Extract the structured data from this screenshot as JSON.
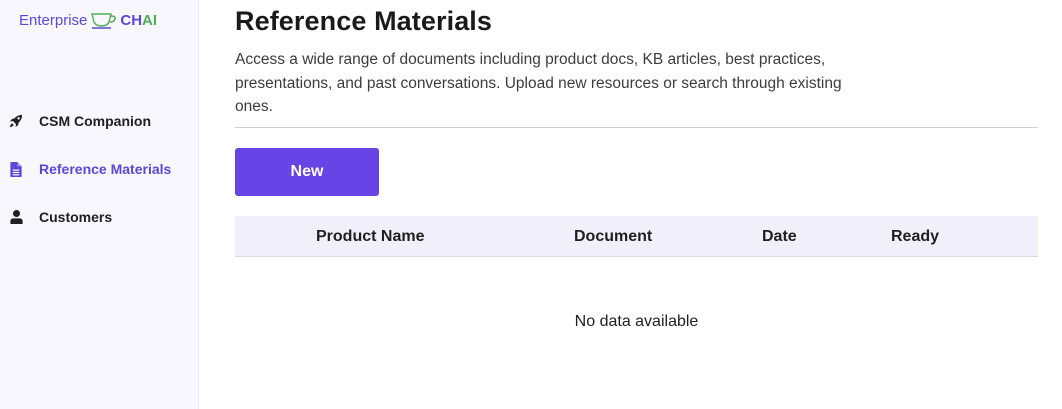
{
  "brand": {
    "prefix": "Enterprise",
    "ch": "CH",
    "ai": "AI",
    "cup_icon": "teacup-icon",
    "colors": {
      "purple": "#5b48d6",
      "green": "#4caf50"
    }
  },
  "sidebar": {
    "items": [
      {
        "label": "CSM Companion",
        "icon": "rocket-icon",
        "active": false
      },
      {
        "label": "Reference Materials",
        "icon": "document-icon",
        "active": true
      },
      {
        "label": "Customers",
        "icon": "user-icon",
        "active": false
      }
    ]
  },
  "main": {
    "title": "Reference Materials",
    "description": "Access a wide range of documents including product docs, KB articles, best practices, presentations, and past conversations. Upload new resources or search through existing ones.",
    "new_button": "New",
    "accent_color": "#6644e6",
    "table": {
      "columns": [
        "Product Name",
        "Document",
        "Date",
        "Ready"
      ],
      "rows": [],
      "empty_text": "No data available"
    }
  }
}
